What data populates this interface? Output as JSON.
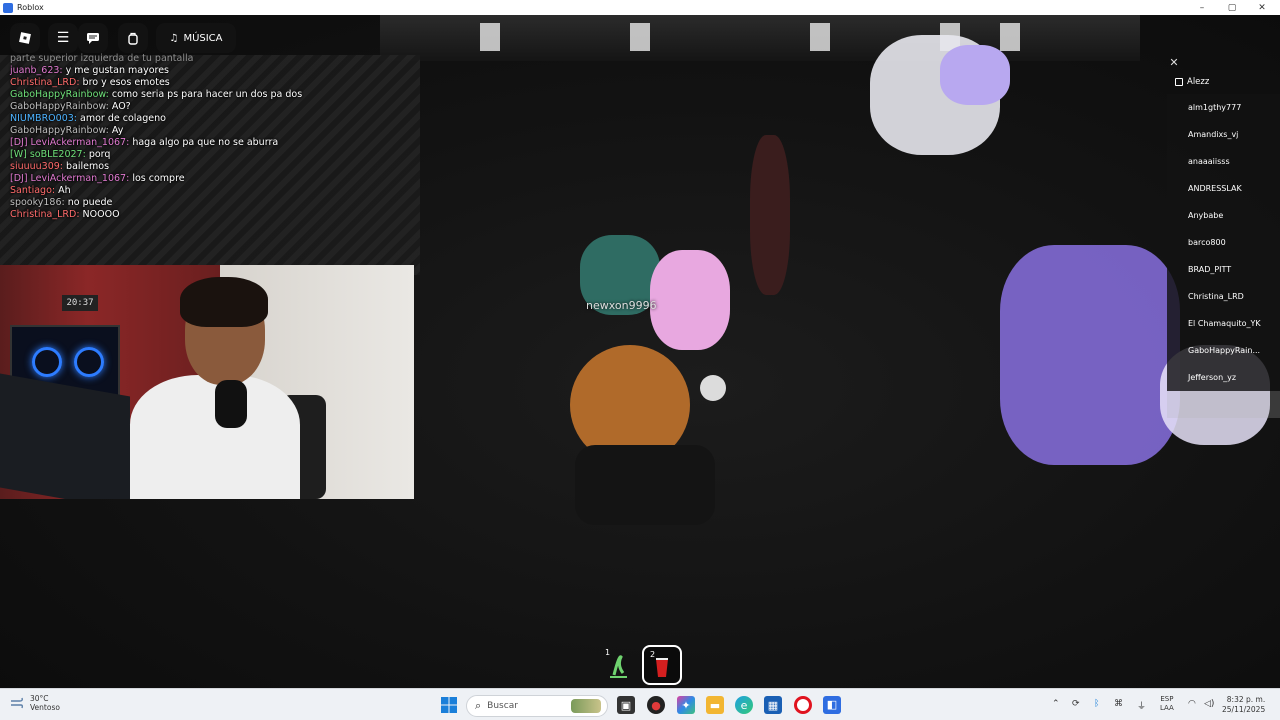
{
  "window": {
    "title": "Roblox",
    "controls": [
      "–",
      "▢",
      "✕"
    ]
  },
  "topbar": {
    "music_label": "MÚSICA"
  },
  "chat": [
    {
      "user": "",
      "text": "parte superior izquierda de tu pantalla",
      "color": "#ffffff"
    },
    {
      "user": "juanb_623:",
      "text": "y me gustan mayores",
      "color": "#e07ad0"
    },
    {
      "user": "Christina_LRD:",
      "text": "bro y esos emotes",
      "color": "#ff6b6b"
    },
    {
      "user": "GaboHappyRainbow:",
      "text": "como  seria ps para hacer un dos pa dos",
      "color": "#6fe07a"
    },
    {
      "user": "GaboHappyRainbow:",
      "text": "AO?",
      "color": "#bfbfbf"
    },
    {
      "user": "NIUMBRO003:",
      "text": "amor de colageno",
      "color": "#4db3ff"
    },
    {
      "user": "GaboHappyRainbow:",
      "text": "Ay",
      "color": "#bfbfbf"
    },
    {
      "user": "[DJ] LeviAckerman_1067:",
      "text": "haga algo pa que no se aburra",
      "color": "#e07ad0"
    },
    {
      "user": "[W] soBLE2027:",
      "text": "porq",
      "color": "#6fe07a"
    },
    {
      "user": "siuuuu309:",
      "text": "bailemos",
      "color": "#ff6b6b"
    },
    {
      "user": "[DJ] LeviAckerman_1067:",
      "text": "los compre",
      "color": "#e07ad0"
    },
    {
      "user": "Santiago:",
      "text": "Ah",
      "color": "#ff6b6b"
    },
    {
      "user": "spooky186:",
      "text": "no puede",
      "color": "#bfbfbf"
    },
    {
      "user": "Christina_LRD:",
      "text": "NOOOO",
      "color": "#ff6b6b"
    }
  ],
  "webcam": {
    "clock_text": "20:37"
  },
  "nametag": "newxon9996",
  "playerlist": {
    "header": "Alezz",
    "players": [
      "alm1gthy777",
      "Amandixs_vj",
      "anaaaiisss",
      "ANDRESSLAK",
      "Anybabe",
      "barco800",
      "BRAD_PITT",
      "Christina_LRD",
      "El Chamaquito_YK",
      "GaboHappyRain...",
      "Jefferson_yz"
    ]
  },
  "hotbar": [
    {
      "num": "1",
      "icon": "plant-icon"
    },
    {
      "num": "2",
      "icon": "red-cup-icon"
    }
  ],
  "taskbar": {
    "weather_temp": "30°C",
    "weather_desc": "Ventoso",
    "search_placeholder": "Buscar",
    "lang_top": "ESP",
    "lang_bottom": "LAA",
    "time": "8:32 p. m.",
    "date": "25/11/2025"
  },
  "colors": {
    "accent": "#2f6de1",
    "opera": "#e0131f"
  }
}
